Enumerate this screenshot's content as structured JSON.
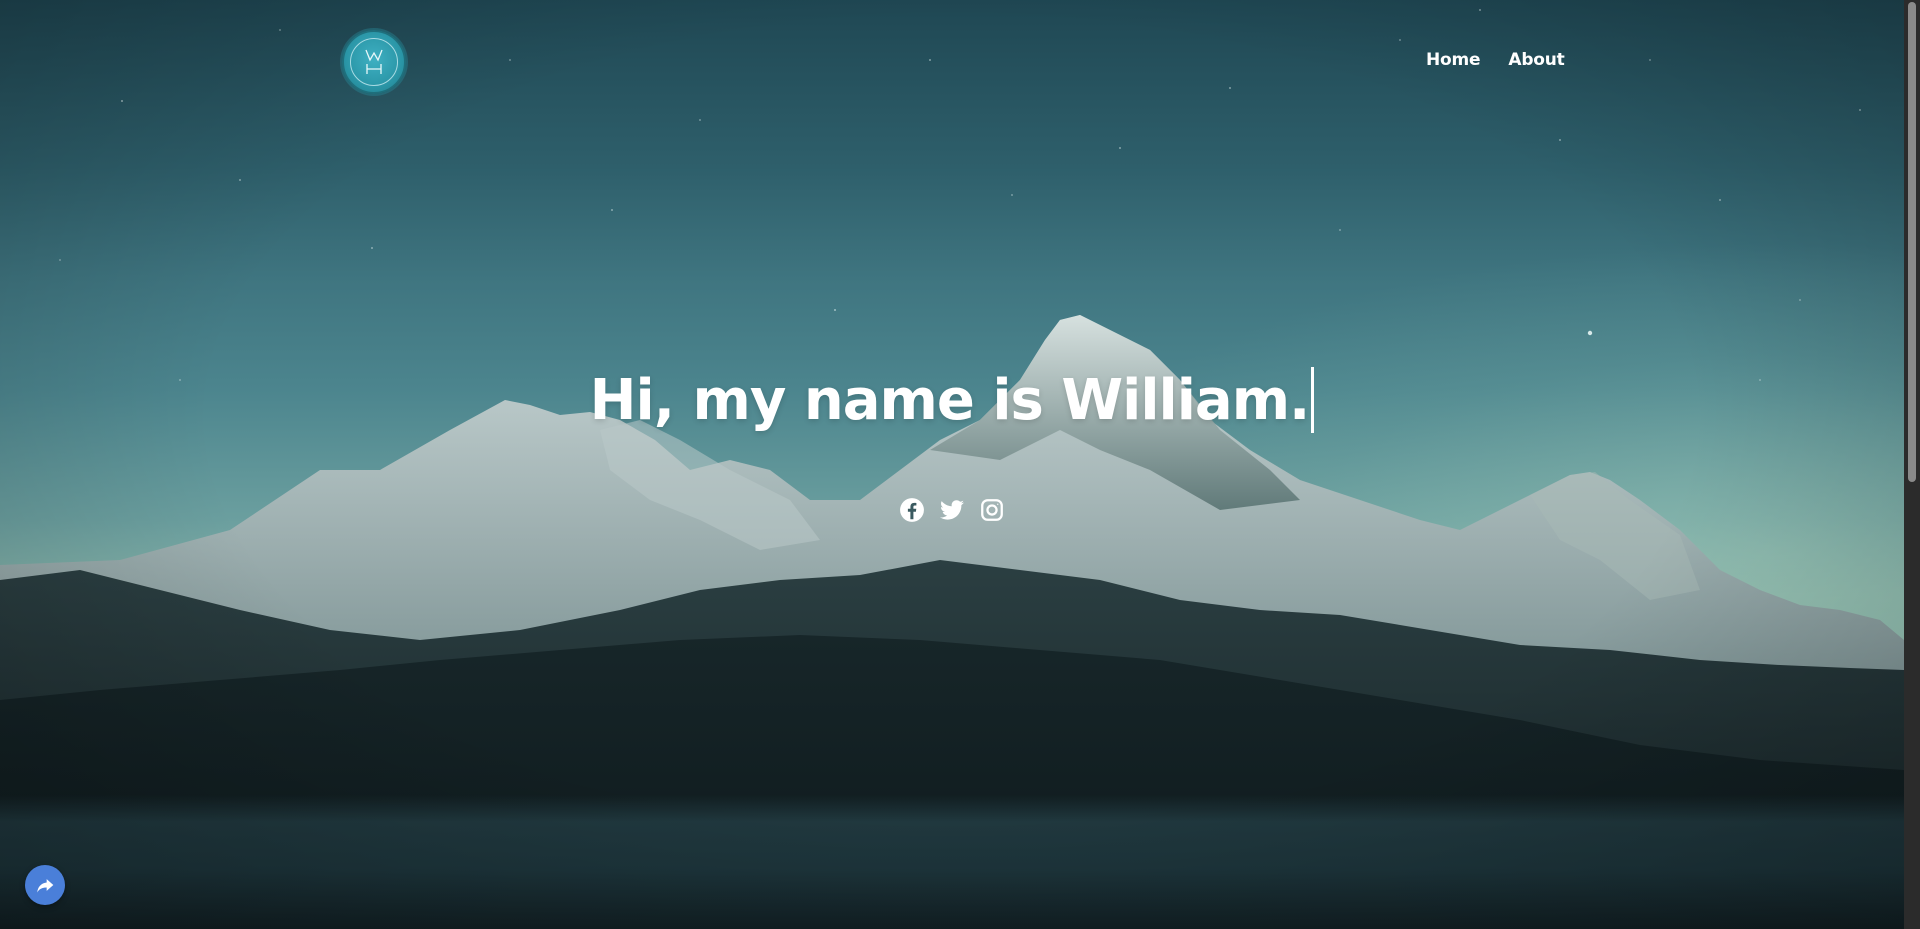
{
  "header": {
    "logo_icon": "wh-monogram-logo",
    "nav": [
      {
        "label": "Home"
      },
      {
        "label": "About"
      }
    ]
  },
  "hero": {
    "title": "Hi, my name is William.",
    "socials": [
      {
        "icon": "facebook-icon"
      },
      {
        "icon": "twitter-icon"
      },
      {
        "icon": "instagram-icon"
      }
    ]
  },
  "floating_button": {
    "icon": "share-arrow-icon",
    "color": "#4a7fd9"
  },
  "colors": {
    "text": "#ffffff",
    "logo_teal": "#2b97a8"
  }
}
